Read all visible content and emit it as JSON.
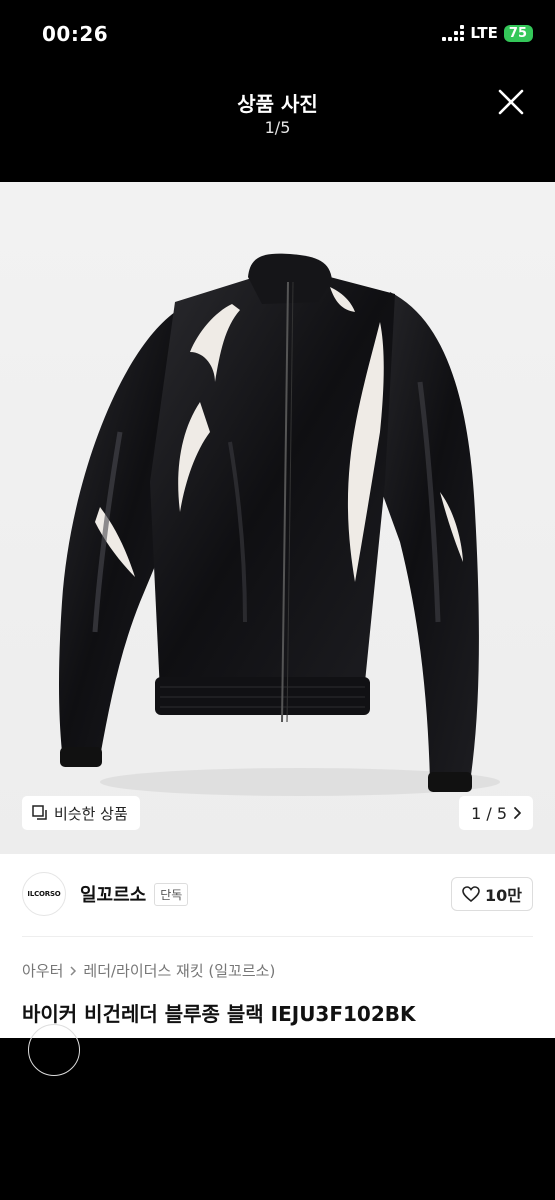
{
  "status": {
    "time": "00:26",
    "network": "LTE",
    "battery": "75"
  },
  "header": {
    "title": "상품 사진",
    "counter": "1/5"
  },
  "photo": {
    "similar_label": "비슷한 상품",
    "pager_label": "1 / 5",
    "pager_icon": "chevron-right-icon"
  },
  "seller": {
    "logo_text": "ILCORSO",
    "name": "일꼬르소",
    "badge": "단독",
    "likes": "10만"
  },
  "breadcrumb": {
    "category": "아우터",
    "subcategory": "레더/라이더스 재킷 (일꼬르소)"
  },
  "product": {
    "title": "바이커 비건레더 블루종 블랙 IEJU3F102BK"
  },
  "colors": {
    "accent_battery": "#34c759",
    "header_bg": "#000000",
    "photo_bg": "#f0f0f0"
  }
}
